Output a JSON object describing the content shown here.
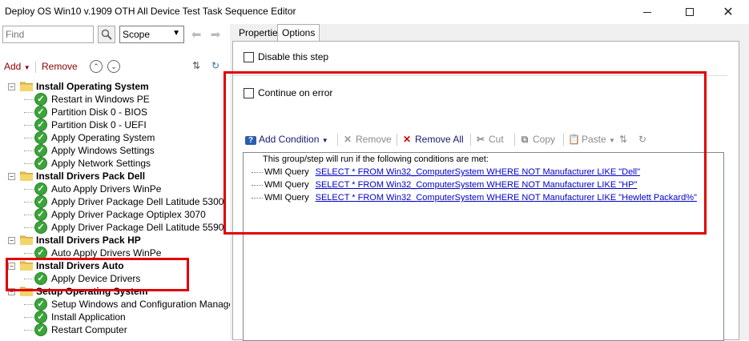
{
  "window": {
    "title": "Deploy OS Win10 v.1909 OTH All Device Test Task Sequence Editor",
    "minimize": "—",
    "maximize": "□",
    "close": "✕"
  },
  "search": {
    "placeholder": "Find",
    "scope": "Scope"
  },
  "left_toolbar": {
    "add_label": "Add",
    "remove_label": "Remove"
  },
  "tree": {
    "rows": [
      {
        "kind": "group",
        "label": "Install Operating System"
      },
      {
        "kind": "step",
        "label": "Restart in Windows PE"
      },
      {
        "kind": "step",
        "label": "Partition Disk 0 - BIOS"
      },
      {
        "kind": "step",
        "label": "Partition Disk 0 - UEFI"
      },
      {
        "kind": "step",
        "label": "Apply Operating System"
      },
      {
        "kind": "step",
        "label": "Apply Windows Settings"
      },
      {
        "kind": "step",
        "label": "Apply Network Settings"
      },
      {
        "kind": "group",
        "label": "Install Drivers Pack Dell"
      },
      {
        "kind": "step",
        "label": "Auto Apply Drivers WinPe"
      },
      {
        "kind": "step",
        "label": "Apply Driver Package Dell Latitude 5300"
      },
      {
        "kind": "step",
        "label": "Apply Driver Package Optiplex 3070"
      },
      {
        "kind": "step",
        "label": "Apply Driver Package Dell Latitude 5590"
      },
      {
        "kind": "group",
        "label": "Install Drivers Pack HP"
      },
      {
        "kind": "step",
        "label": "Auto Apply Drivers WinPe"
      },
      {
        "kind": "group",
        "label": "Install Drivers Auto"
      },
      {
        "kind": "step",
        "label": "Apply Device Drivers"
      },
      {
        "kind": "group",
        "label": "Setup Operating System"
      },
      {
        "kind": "step",
        "label": "Setup Windows and Configuration Manager"
      },
      {
        "kind": "step",
        "label": "Install Application"
      },
      {
        "kind": "step",
        "label": "Restart Computer"
      }
    ]
  },
  "tabs": {
    "properties": "Properties",
    "options": "Options"
  },
  "options": {
    "disable_step": "Disable this step",
    "continue_on_error": "Continue on error"
  },
  "cond_toolbar": {
    "add_condition": "Add Condition",
    "remove": "Remove",
    "remove_all": "Remove All",
    "cut": "Cut",
    "copy": "Copy",
    "paste": "Paste"
  },
  "conditions": {
    "intro": "This group/step will run if the following conditions are met:",
    "items": [
      {
        "type": "WMI Query",
        "query": "SELECT * FROM Win32_ComputerSystem WHERE NOT Manufacturer LIKE \"Dell\""
      },
      {
        "type": "WMI Query",
        "query": "SELECT * FROM Win32_ComputerSystem WHERE NOT Manufacturer LIKE \"HP\""
      },
      {
        "type": "WMI Query",
        "query": "SELECT * FROM Win32_ComputerSystem WHERE NOT Manufacturer LIKE \"Hewlett Packard%\""
      }
    ]
  },
  "colors": {
    "highlight": "#e00000",
    "step_ok": "#3aa53a",
    "link": "#0000cc"
  }
}
